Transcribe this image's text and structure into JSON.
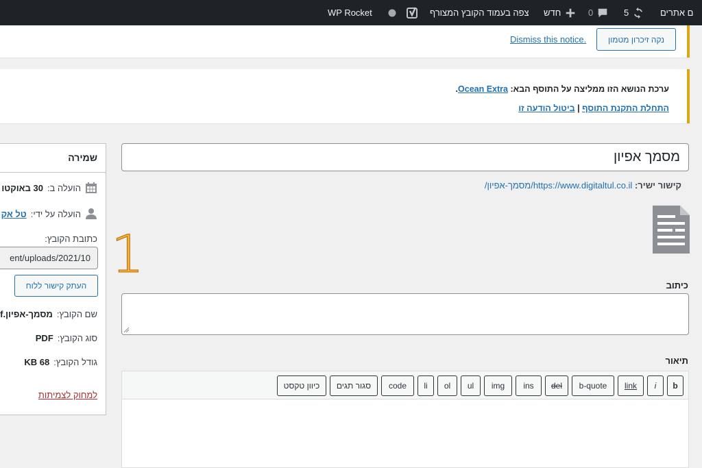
{
  "adminbar": {
    "sites": "ם אתרים",
    "updates_count": "5",
    "comments_count": "0",
    "new_label": "חדש",
    "view_label": "צפה בעמוד הקובץ המצורף",
    "rocket_label": "WP Rocket"
  },
  "notice_cache": {
    "clear_button": "נקה זיכרון מטמון",
    "dismiss": "Dismiss this notice."
  },
  "notice_plugin": {
    "message": "ערכת הנושא הזו ממליצה על התוסף הבא:",
    "plugin_name": "Ocean Extra",
    "period": ".",
    "install_link": "התחלת התקנת התוסף",
    "separator": "|",
    "dismiss_link": "ביטול הודעה זו"
  },
  "title": {
    "value": "מסמך אפיון"
  },
  "permalink": {
    "label": "קישור ישיר:",
    "url": "https://www.digitaltul.co.il/מסמך-אפיון/"
  },
  "caption": {
    "label": "כיתוב",
    "value": ""
  },
  "description": {
    "label": "תיאור",
    "buttons": [
      "b",
      "i",
      "link",
      "b-quote",
      "del",
      "ins",
      "img",
      "ul",
      "ol",
      "li",
      "code",
      "סגור תגים",
      "כיוון טקסט"
    ]
  },
  "sidebar": {
    "heading": "שמירה",
    "uploaded_on_label": "הועלה ב:",
    "uploaded_on_value": "30 באוקטו",
    "uploaded_by_label": "הועלה על ידי:",
    "uploaded_by_value": "טל אק",
    "file_url_label": "כתובת הקובץ:",
    "file_url_value": "ent/uploads/2021/10",
    "copy_button": "העתק קישור ללוח",
    "file_name_label": "שם הקובץ:",
    "file_name_value": "מסמך-אפיון.df",
    "file_type_label": "סוג הקובץ:",
    "file_type_value": "PDF",
    "file_size_label": "גודל הקובץ:",
    "file_size_value": "68 KB",
    "delete_link": "למחוק לצמיתות"
  },
  "annotation": {
    "number": "1"
  },
  "colors": {
    "accent": "#2271b1",
    "notice": "#dba617",
    "danger": "#b32d2e",
    "annotation": "#fbb03b"
  }
}
